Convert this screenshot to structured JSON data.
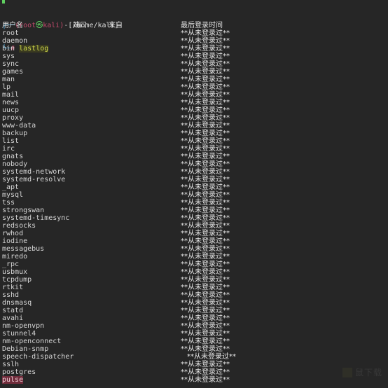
{
  "terminal": {
    "colors": {
      "background": "#262626",
      "foreground": "#d6d6d6",
      "prompt_user": "#c04a6b",
      "prompt_at": "#5fcf5f",
      "prompt_box": "#4fa8d8",
      "command": "#cfd84a",
      "selection": "#6f2b3a"
    },
    "prompt": {
      "box_top": "┌──",
      "open_paren": "(",
      "user": "root",
      "at_symbol": "㉿",
      "host": "kali",
      "close_paren": ")",
      "dash": "-",
      "path": "[/home/kali]",
      "box_bottom": "└─",
      "hash": "#",
      "command": "lastlog"
    },
    "table": {
      "headers": {
        "username": "用户名",
        "port": "端口",
        "from": "来自",
        "last_login": "最后登录时间"
      },
      "never_logged_in": "**从未登录过**",
      "rows": [
        {
          "username": "root",
          "port": "",
          "from": "",
          "last_login": "**从未登录过**",
          "indented": false
        },
        {
          "username": "daemon",
          "port": "",
          "from": "",
          "last_login": "**从未登录过**",
          "indented": false
        },
        {
          "username": "bin",
          "port": "",
          "from": "",
          "last_login": "**从未登录过**",
          "indented": false
        },
        {
          "username": "sys",
          "port": "",
          "from": "",
          "last_login": "**从未登录过**",
          "indented": false
        },
        {
          "username": "sync",
          "port": "",
          "from": "",
          "last_login": "**从未登录过**",
          "indented": false
        },
        {
          "username": "games",
          "port": "",
          "from": "",
          "last_login": "**从未登录过**",
          "indented": false
        },
        {
          "username": "man",
          "port": "",
          "from": "",
          "last_login": "**从未登录过**",
          "indented": false
        },
        {
          "username": "lp",
          "port": "",
          "from": "",
          "last_login": "**从未登录过**",
          "indented": false
        },
        {
          "username": "mail",
          "port": "",
          "from": "",
          "last_login": "**从未登录过**",
          "indented": false
        },
        {
          "username": "news",
          "port": "",
          "from": "",
          "last_login": "**从未登录过**",
          "indented": false
        },
        {
          "username": "uucp",
          "port": "",
          "from": "",
          "last_login": "**从未登录过**",
          "indented": false
        },
        {
          "username": "proxy",
          "port": "",
          "from": "",
          "last_login": "**从未登录过**",
          "indented": false
        },
        {
          "username": "www-data",
          "port": "",
          "from": "",
          "last_login": "**从未登录过**",
          "indented": false
        },
        {
          "username": "backup",
          "port": "",
          "from": "",
          "last_login": "**从未登录过**",
          "indented": false
        },
        {
          "username": "list",
          "port": "",
          "from": "",
          "last_login": "**从未登录过**",
          "indented": false
        },
        {
          "username": "irc",
          "port": "",
          "from": "",
          "last_login": "**从未登录过**",
          "indented": false
        },
        {
          "username": "gnats",
          "port": "",
          "from": "",
          "last_login": "**从未登录过**",
          "indented": false
        },
        {
          "username": "nobody",
          "port": "",
          "from": "",
          "last_login": "**从未登录过**",
          "indented": false
        },
        {
          "username": "systemd-network",
          "port": "",
          "from": "",
          "last_login": "**从未登录过**",
          "indented": false
        },
        {
          "username": "systemd-resolve",
          "port": "",
          "from": "",
          "last_login": "**从未登录过**",
          "indented": false
        },
        {
          "username": "_apt",
          "port": "",
          "from": "",
          "last_login": "**从未登录过**",
          "indented": false
        },
        {
          "username": "mysql",
          "port": "",
          "from": "",
          "last_login": "**从未登录过**",
          "indented": false
        },
        {
          "username": "tss",
          "port": "",
          "from": "",
          "last_login": "**从未登录过**",
          "indented": false
        },
        {
          "username": "strongswan",
          "port": "",
          "from": "",
          "last_login": "**从未登录过**",
          "indented": false
        },
        {
          "username": "systemd-timesync",
          "port": "",
          "from": "",
          "last_login": "**从未登录过**",
          "indented": false
        },
        {
          "username": "redsocks",
          "port": "",
          "from": "",
          "last_login": "**从未登录过**",
          "indented": false
        },
        {
          "username": "rwhod",
          "port": "",
          "from": "",
          "last_login": "**从未登录过**",
          "indented": false
        },
        {
          "username": "iodine",
          "port": "",
          "from": "",
          "last_login": "**从未登录过**",
          "indented": false
        },
        {
          "username": "messagebus",
          "port": "",
          "from": "",
          "last_login": "**从未登录过**",
          "indented": false
        },
        {
          "username": "miredo",
          "port": "",
          "from": "",
          "last_login": "**从未登录过**",
          "indented": false
        },
        {
          "username": "_rpc",
          "port": "",
          "from": "",
          "last_login": "**从未登录过**",
          "indented": false
        },
        {
          "username": "usbmux",
          "port": "",
          "from": "",
          "last_login": "**从未登录过**",
          "indented": false
        },
        {
          "username": "tcpdump",
          "port": "",
          "from": "",
          "last_login": "**从未登录过**",
          "indented": false
        },
        {
          "username": "rtkit",
          "port": "",
          "from": "",
          "last_login": "**从未登录过**",
          "indented": false
        },
        {
          "username": "sshd",
          "port": "",
          "from": "",
          "last_login": "**从未登录过**",
          "indented": false
        },
        {
          "username": "dnsmasq",
          "port": "",
          "from": "",
          "last_login": "**从未登录过**",
          "indented": false
        },
        {
          "username": "statd",
          "port": "",
          "from": "",
          "last_login": "**从未登录过**",
          "indented": false
        },
        {
          "username": "avahi",
          "port": "",
          "from": "",
          "last_login": "**从未登录过**",
          "indented": false
        },
        {
          "username": "nm-openvpn",
          "port": "",
          "from": "",
          "last_login": "**从未登录过**",
          "indented": false
        },
        {
          "username": "stunnel4",
          "port": "",
          "from": "",
          "last_login": "**从未登录过**",
          "indented": false
        },
        {
          "username": "nm-openconnect",
          "port": "",
          "from": "",
          "last_login": "**从未登录过**",
          "indented": false
        },
        {
          "username": "Debian-snmp",
          "port": "",
          "from": "",
          "last_login": "**从未登录过**",
          "indented": false
        },
        {
          "username": "speech-dispatcher",
          "port": "",
          "from": "",
          "last_login": "**从未登录过**",
          "indented": true
        },
        {
          "username": "sslh",
          "port": "",
          "from": "",
          "last_login": "**从未登录过**",
          "indented": false
        },
        {
          "username": "postgres",
          "port": "",
          "from": "",
          "last_login": "**从未登录过**",
          "indented": false
        },
        {
          "username": "pulse",
          "port": "",
          "from": "",
          "last_login": "**从未登录过**",
          "indented": false,
          "selected": true
        }
      ]
    },
    "watermark": {
      "text": "鼠下载"
    }
  }
}
